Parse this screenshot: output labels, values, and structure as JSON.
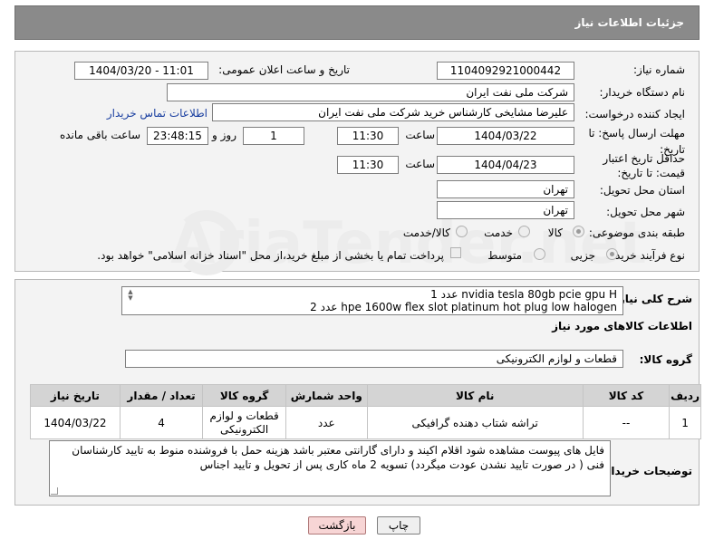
{
  "header": {
    "title": "جزئیات اطلاعات نیاز"
  },
  "fields": {
    "need_number_label": "شماره نیاز:",
    "need_number": "1104092921000442",
    "announce_label": "تاریخ و ساعت اعلان عمومی:",
    "announce_value": "1404/03/20 - 11:01",
    "buyer_org_label": "نام دستگاه خریدار:",
    "buyer_org": "شرکت ملی نفت ایران",
    "creator_label": "ایجاد کننده درخواست:",
    "creator": "علیرضا مشایخی کارشناس خرید  شرکت ملی نفت ایران",
    "contact_link": "اطلاعات تماس خریدار",
    "deadline_label": "مهلت ارسال پاسخ: تا تاریخ:",
    "deadline_date": "1404/03/22",
    "time_label": "ساعت",
    "deadline_time": "11:30",
    "days_value": "1",
    "days_label": "روز و",
    "remaining_time": "23:48:15",
    "remaining_label": "ساعت باقی مانده",
    "min_validity_label": "حداقل تاریخ اعتبار قیمت: تا تاریخ:",
    "validity_date": "1404/04/23",
    "validity_time": "11:30",
    "province_label": "استان محل تحویل:",
    "province": "تهران",
    "city_label": "شهر محل تحویل:",
    "city": "تهران",
    "category_label": "طبقه بندی موضوعی:",
    "category_options": [
      "کالا",
      "خدمت",
      "کالا/خدمت"
    ],
    "process_label": "نوع فرآیند خرید :",
    "process_options": [
      "جزیی",
      "متوسط"
    ],
    "payment_note": "پرداخت تمام یا بخشی از مبلغ خرید،از محل \"اسناد خزانه اسلامی\" خواهد بود."
  },
  "summary": {
    "label": "شرح کلی نیاز:",
    "lines": [
      "1 عدد nvidia tesla 80gb pcie gpu H",
      "2 عدد hpe 1600w flex slot platinum hot plug low halogen"
    ]
  },
  "goods_info_title": "اطلاعات کالاهای مورد نیاز",
  "goods_group": {
    "label": "گروه کالا:",
    "value": "قطعات و لوازم الکترونیکی"
  },
  "table": {
    "headers": [
      "ردیف",
      "کد کالا",
      "نام کالا",
      "واحد شمارش",
      "گروه کالا",
      "تعداد / مقدار",
      "تاریخ نیاز"
    ],
    "rows": [
      {
        "row": "1",
        "code": "--",
        "name": "تراشه شتاب دهنده گرافیکی",
        "unit": "عدد",
        "group": "قطعات و لوازم الکترونیکی",
        "qty": "4",
        "date": "1404/03/22"
      }
    ]
  },
  "buyer_notes": {
    "label": "توضیحات خریدار:",
    "text": "فایل های پیوست مشاهده شود اقلام اکیند و دارای گارانتی معتبر باشد  هزینه حمل با فروشنده منوط به تایید کارشناسان فنی ( در صورت تایید نشدن عودت میگردد) تسویه 2 ماه کاری پس از تحویل و تایید اجناس"
  },
  "buttons": {
    "print": "چاپ",
    "back": "بازگشت"
  },
  "watermark": "AriaTender.net"
}
